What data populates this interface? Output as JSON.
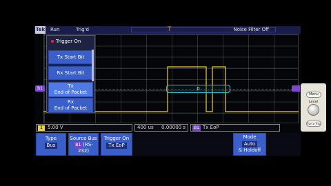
{
  "topbar": {
    "brand": "Tek",
    "run_state": "Run",
    "trigger_state": "Trig'd",
    "noise_filter": "Noise Filter Off"
  },
  "trigger_position_marker": "T",
  "waveform_markers": {
    "bus_marker": "B1"
  },
  "bus_decode": {
    "value": "0"
  },
  "trigger_menu": {
    "title": "Trigger On",
    "items": [
      {
        "label": "Tx Start Bit",
        "selected": false
      },
      {
        "label": "Rx Start Bit",
        "selected": false
      },
      {
        "line1": "Tx",
        "line2": "End of Packet",
        "selected": true
      },
      {
        "line1": "Rx",
        "line2": "End of Packet",
        "selected": false
      }
    ]
  },
  "status": {
    "ch1_badge": "1",
    "ch1_scale": "5.00 V",
    "timebase": "400 us",
    "position": "0.00000 s",
    "trigger_badge": "B1",
    "trigger_label": "Tx EoP"
  },
  "bottom_menu": {
    "type_label": "Type",
    "type_value": "Bus",
    "source_label": "Source Bus",
    "source_badge": "B1",
    "source_value": "(RS-232)",
    "trigger_on_label": "Trigger On",
    "trigger_on_value": "Tx EoP",
    "mode_label": "Mode",
    "mode_value1": "Auto",
    "mode_value2": "& Holdoff"
  },
  "side_panel": {
    "menu_button": "Menu",
    "level_label": "Level",
    "force_trig": "Force Trig"
  },
  "colors": {
    "ch1_trace": "#e8d43a",
    "bus": "#38c0c8",
    "menu_blue": "#3b5fc8",
    "trigger_orange": "#f08a1c",
    "bus_purple": "#7a48c8"
  }
}
